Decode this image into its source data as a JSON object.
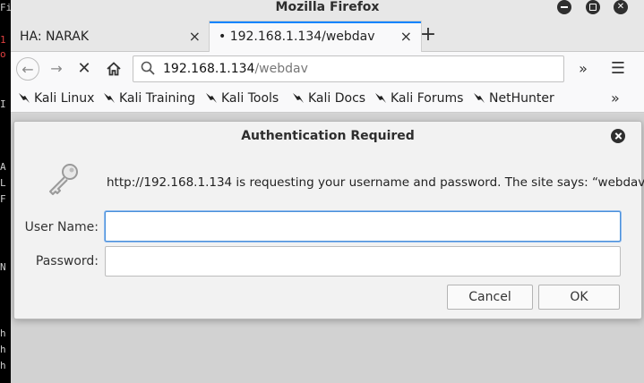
{
  "window": {
    "title": "Mozilla Firefox"
  },
  "tabs": [
    {
      "label": "HA: NARAK",
      "close": "×"
    },
    {
      "label": "• 192.168.1.134/webdav",
      "close": "×"
    }
  ],
  "new_tab": "+",
  "nav": {
    "back": "←",
    "forward": "→",
    "stop": "✕",
    "home": "⌂",
    "url_host": "192.168.1.134",
    "url_path": "/webdav",
    "overflow": "»",
    "menu": "☰"
  },
  "bookmarks": {
    "items": [
      "Kali Linux",
      "Kali Training",
      "Kali Tools",
      "Kali Docs",
      "Kali Forums",
      "NetHunter"
    ],
    "more": "»"
  },
  "dialog": {
    "title": "Authentication Required",
    "message": "http://192.168.1.134 is requesting your username and password. The site says: “webdav”",
    "username_label": "User Name:",
    "username_value": "",
    "password_label": "Password:",
    "password_value": "",
    "cancel": "Cancel",
    "ok": "OK"
  },
  "colors": {
    "accent": "#0a84ff",
    "focus": "#4a90d9"
  },
  "icons": [
    "search-icon",
    "key-icon",
    "dragon-icon",
    "close-icon",
    "home-icon"
  ]
}
